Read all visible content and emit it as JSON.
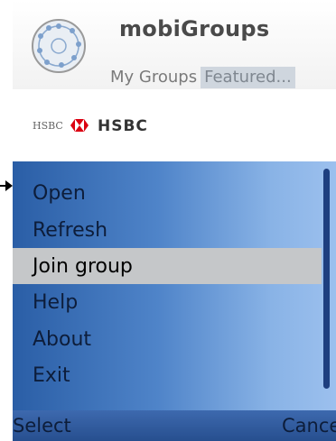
{
  "header": {
    "title": "mobiGroups",
    "tabs": [
      {
        "label": "My Groups",
        "active": false
      },
      {
        "label": "Featured...",
        "active": true
      }
    ]
  },
  "group": {
    "logo_text": "HSBC",
    "name": "HSBC"
  },
  "menu": {
    "items": [
      {
        "label": "Open"
      },
      {
        "label": "Refresh"
      },
      {
        "label": "Join group",
        "selected": true
      },
      {
        "label": "Help"
      },
      {
        "label": "About"
      },
      {
        "label": "Exit"
      }
    ]
  },
  "softkeys": {
    "left": "Select",
    "right": "Cance"
  },
  "colors": {
    "menu_gradient_start": "#2a5ea6",
    "menu_gradient_end": "#9cc0ee",
    "selected_bg": "#c5c7c9",
    "tab_active_bg": "#cfd6de",
    "hsbc_red": "#db0011"
  }
}
